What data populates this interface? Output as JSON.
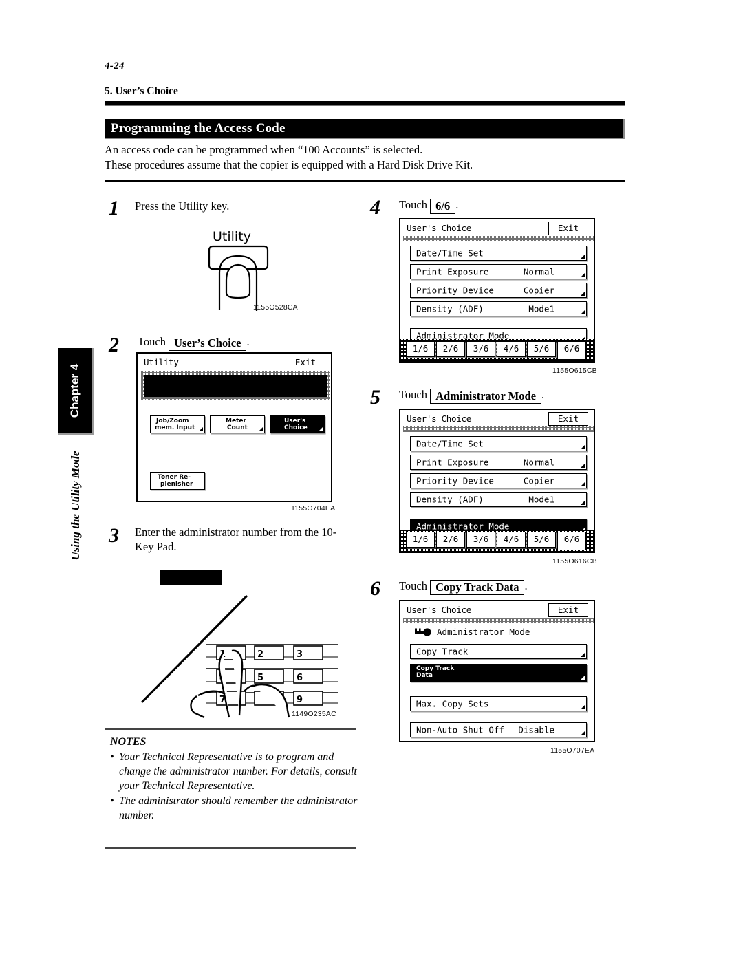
{
  "page": {
    "number": "4-24",
    "running_head": "5. User’s Choice",
    "section_title": "Programming the Access Code",
    "intro_line1": "An access code can be programmed when “100 Accounts” is selected.",
    "intro_line2": "These procedures assume that the copier is equipped with a Hard Disk Drive Kit.",
    "chapter_tab": "Chapter 4",
    "chapter_subtitle": "Using the Utility Mode"
  },
  "steps": {
    "s1": {
      "num": "1",
      "text": "Press the Utility key."
    },
    "s2": {
      "num": "2",
      "touch": "Touch",
      "key": "User’s Choice",
      "period": "."
    },
    "s3": {
      "num": "3",
      "text": "Enter the administrator number from the 10-Key Pad."
    },
    "s4": {
      "num": "4",
      "touch": "Touch",
      "key": "6/6",
      "period": "."
    },
    "s5": {
      "num": "5",
      "touch": "Touch",
      "key": "Administrator Mode",
      "period": "."
    },
    "s6": {
      "num": "6",
      "touch": "Touch",
      "key": "Copy Track Data",
      "period": "."
    }
  },
  "fig_utility": {
    "key_label": "Utility",
    "code": "1155O528CA"
  },
  "fig_keypad": {
    "keys": [
      "1",
      "2",
      "3",
      "4",
      "5",
      "6",
      "7",
      "9"
    ],
    "code": "1149O235AC"
  },
  "lcd_utility": {
    "title": "Utility",
    "exit": "Exit",
    "buttons": [
      {
        "label": "Job/Zoom\nmem. Input",
        "line1": "Job/Zoom",
        "line2": "mem. Input",
        "selected": false
      },
      {
        "label": "Meter Count",
        "line1": "Meter",
        "line2": "Count",
        "selected": false
      },
      {
        "label": "User’s Choice",
        "line1": "User's",
        "line2": "Choice",
        "selected": true
      },
      {
        "label": "Toner Re-plenisher",
        "line1": "Toner Re-",
        "line2": "plenisher",
        "selected": false
      }
    ],
    "code": "1155O704EA"
  },
  "lcd_userschoice_a": {
    "title": "User's Choice",
    "exit": "Exit",
    "rows": [
      {
        "label": "Date/Time Set",
        "value": "",
        "selected": false
      },
      {
        "label": "Print Exposure",
        "value": "Normal",
        "selected": false
      },
      {
        "label": "Priority Device",
        "value": "Copier",
        "selected": false
      },
      {
        "label": "Density (ADF)",
        "value": "Mode1",
        "selected": false
      }
    ],
    "admin_row": {
      "label": "Administrator Mode",
      "value": "",
      "selected": false
    },
    "tabs": [
      "1/6",
      "2/6",
      "3/6",
      "4/6",
      "5/6",
      "6/6"
    ],
    "active_tab": "6/6",
    "code": "1155O615CB"
  },
  "lcd_userschoice_b": {
    "title": "User's Choice",
    "exit": "Exit",
    "rows": [
      {
        "label": "Date/Time Set",
        "value": "",
        "selected": false
      },
      {
        "label": "Print Exposure",
        "value": "Normal",
        "selected": false
      },
      {
        "label": "Priority Device",
        "value": "Copier",
        "selected": false
      },
      {
        "label": "Density (ADF)",
        "value": "Mode1",
        "selected": false
      }
    ],
    "admin_row": {
      "label": "Administrator Mode",
      "value": "",
      "selected": true
    },
    "tabs": [
      "1/6",
      "2/6",
      "3/6",
      "4/6",
      "5/6",
      "6/6"
    ],
    "active_tab": "6/6",
    "code": "1155O616CB"
  },
  "lcd_admin": {
    "title": "User's Choice",
    "exit": "Exit",
    "header": "Administrator Mode",
    "header_icon": "key-icon",
    "rows": [
      {
        "label": "Copy Track",
        "value": "",
        "selected": false
      },
      {
        "line1": "Copy Track",
        "line2": "Data",
        "label": "Copy Track Data",
        "value": "",
        "selected": true
      },
      {
        "label": "Max. Copy Sets",
        "value": "",
        "selected": false
      },
      {
        "label": "Non-Auto Shut Off",
        "value": "Disable",
        "selected": false
      }
    ],
    "code": "1155O707EA"
  },
  "notes": {
    "header": "NOTES",
    "items": [
      "Your Technical Representative is to program and change the administrator number. For details, consult your Technical Representative.",
      "The administrator should remember the administrator number."
    ]
  }
}
